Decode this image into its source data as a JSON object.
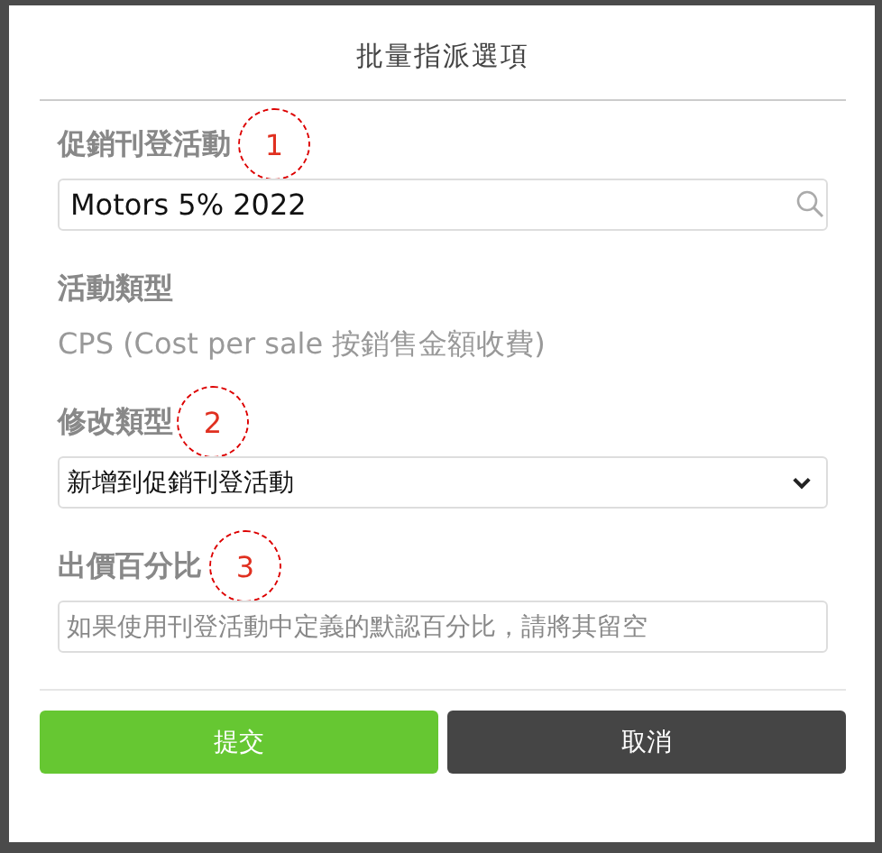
{
  "dialog": {
    "title": "批量指派選項"
  },
  "fields": [
    {
      "kind": "search",
      "label": "促銷刊登活動",
      "value": "Motors 5% 2022",
      "annotation": "1"
    },
    {
      "kind": "static",
      "label": "活動類型",
      "value": "CPS (Cost per sale 按銷售金額收費)"
    },
    {
      "kind": "select",
      "label": "修改類型",
      "value": "新增到促銷刊登活動",
      "annotation": "2"
    },
    {
      "kind": "input",
      "label": "出價百分比",
      "placeholder": "如果使用刊登活動中定義的默認百分比，請將其留空",
      "annotation": "3"
    }
  ],
  "buttons": [
    {
      "label": "提交",
      "kind": "primary"
    },
    {
      "label": "取消",
      "kind": "secondary"
    }
  ]
}
